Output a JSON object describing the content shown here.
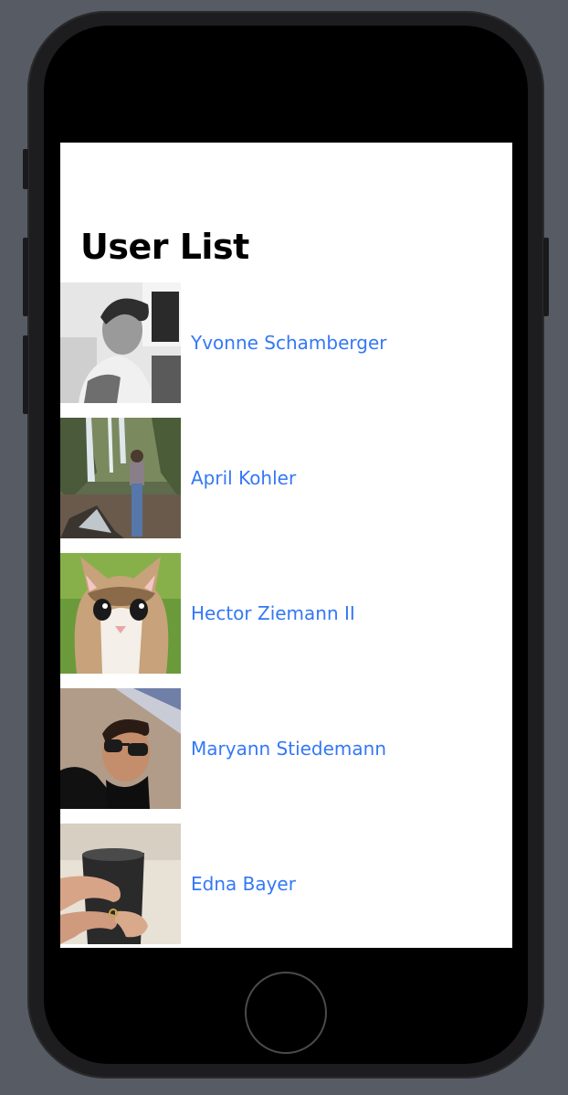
{
  "page": {
    "title": "User List"
  },
  "users": [
    {
      "name": "Yvonne Schamberger",
      "avatar_icon": "user-photo-man-grayscale"
    },
    {
      "name": "April Kohler",
      "avatar_icon": "user-photo-waterfall"
    },
    {
      "name": "Hector Ziemann II",
      "avatar_icon": "user-photo-cat"
    },
    {
      "name": "Maryann Stiedemann",
      "avatar_icon": "user-photo-man-sunglasses"
    },
    {
      "name": "Edna Bayer",
      "avatar_icon": "user-photo-hands-cup"
    }
  ],
  "colors": {
    "link": "#3478f6",
    "background": "#ffffff",
    "device": "#1d1d1f"
  }
}
